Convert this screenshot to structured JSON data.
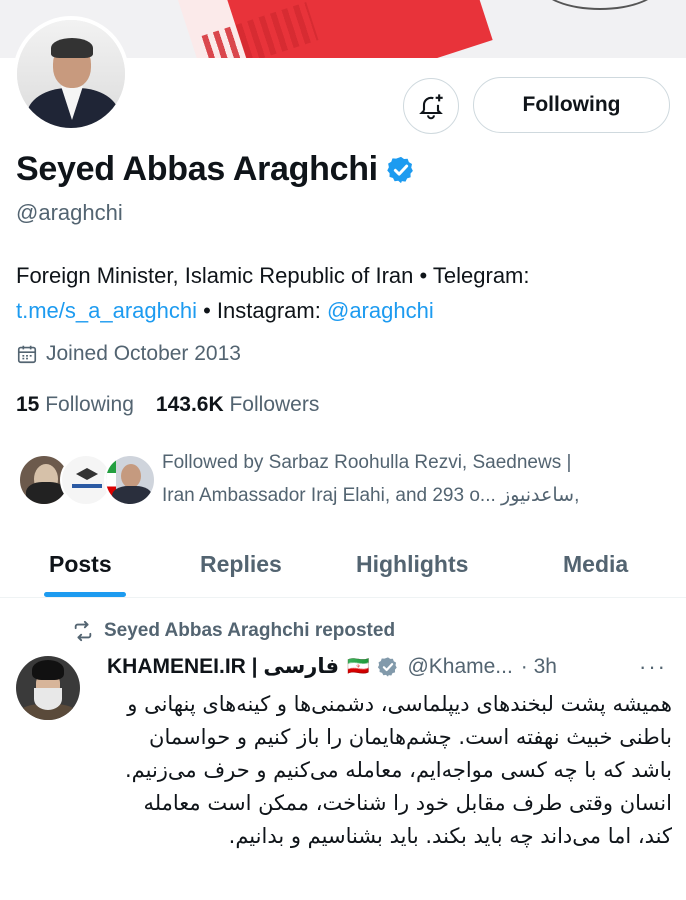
{
  "profile": {
    "name": "Seyed Abbas Araghchi",
    "handle": "@araghchi",
    "bio_text": "Foreign Minister, Islamic Republic of Iran • Telegram:",
    "bio_link_telegram": "t.me/s_a_araghchi",
    "bio_instagram_label": " • Instagram: ",
    "bio_link_instagram": "@araghchi",
    "joined": "Joined October 2013",
    "following_count": "15",
    "following_label": "Following",
    "followers_count": "143.6K",
    "followers_label": "Followers",
    "followed_by_line1": "Followed by Sarbaz Roohulla Rezvi, Saednews |",
    "followed_by_line2": "Iran Ambassador Iraj Elahi, and 293 o... ساعدنیوز,"
  },
  "actions": {
    "follow_button": "Following",
    "notify_icon": "bell-plus-icon"
  },
  "tabs": [
    {
      "label": "Posts",
      "active": true
    },
    {
      "label": "Replies",
      "active": false
    },
    {
      "label": "Highlights",
      "active": false
    },
    {
      "label": "Media",
      "active": false
    }
  ],
  "post": {
    "repost_label": "Seyed Abbas Araghchi reposted",
    "author_name": "KHAMENEI.IR | فارسی",
    "flag": "🇮🇷",
    "author_handle": "@Khame...",
    "time": "· 3h",
    "more": "···",
    "text": "همیشه پشت لبخندهای دیپلماسی، دشمنی‌ها و کینه‌های پنهانی و باطنی خبیث نهفته است. چشم‌هایمان را باز کنیم و حواسمان باشد که با چه کسی مواجه‌ایم، معامله می‌کنیم و حرف می‌زنیم. انسان وقتی طرف مقابل خود را شناخت، ممکن است معامله کند، اما می‌داند چه باید بکند. باید بشناسیم و بدانیم."
  },
  "colors": {
    "accent": "#1d9bf0",
    "secondary_text": "#536471",
    "verified_blue": "#1d9bf0",
    "verified_gray": "#829aab"
  }
}
